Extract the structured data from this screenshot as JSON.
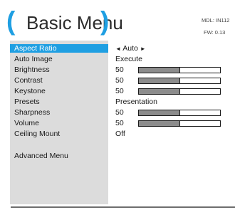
{
  "header": {
    "open_paren": "(",
    "title": "Basic Menu",
    "close_paren": ")",
    "model": "MDL: IN112",
    "firmware": "FW: 0.13"
  },
  "colors": {
    "accent": "#1f9fe2",
    "menu_background": "#dcdcdc",
    "bar_fill": "#8c8c8c"
  },
  "menu": {
    "items": [
      {
        "label": "Aspect Ratio",
        "value": "Auto",
        "type": "selector",
        "left_arrow": "◄",
        "right_arrow": "►",
        "selected": true
      },
      {
        "label": "Auto Image",
        "value": "Execute",
        "type": "text"
      },
      {
        "label": "Brightness",
        "value": "50",
        "type": "slider",
        "level": 0.5
      },
      {
        "label": "Contrast",
        "value": "50",
        "type": "slider",
        "level": 0.5
      },
      {
        "label": "Keystone",
        "value": "50",
        "type": "slider",
        "level": 0.5
      },
      {
        "label": "Presets",
        "value": "Presentation",
        "type": "text"
      },
      {
        "label": "Sharpness",
        "value": "50",
        "type": "slider",
        "level": 0.5
      },
      {
        "label": "Volume",
        "value": "50",
        "type": "slider",
        "level": 0.5
      },
      {
        "label": "Ceiling Mount",
        "value": "Off",
        "type": "text"
      }
    ],
    "advanced_label": "Advanced Menu"
  }
}
